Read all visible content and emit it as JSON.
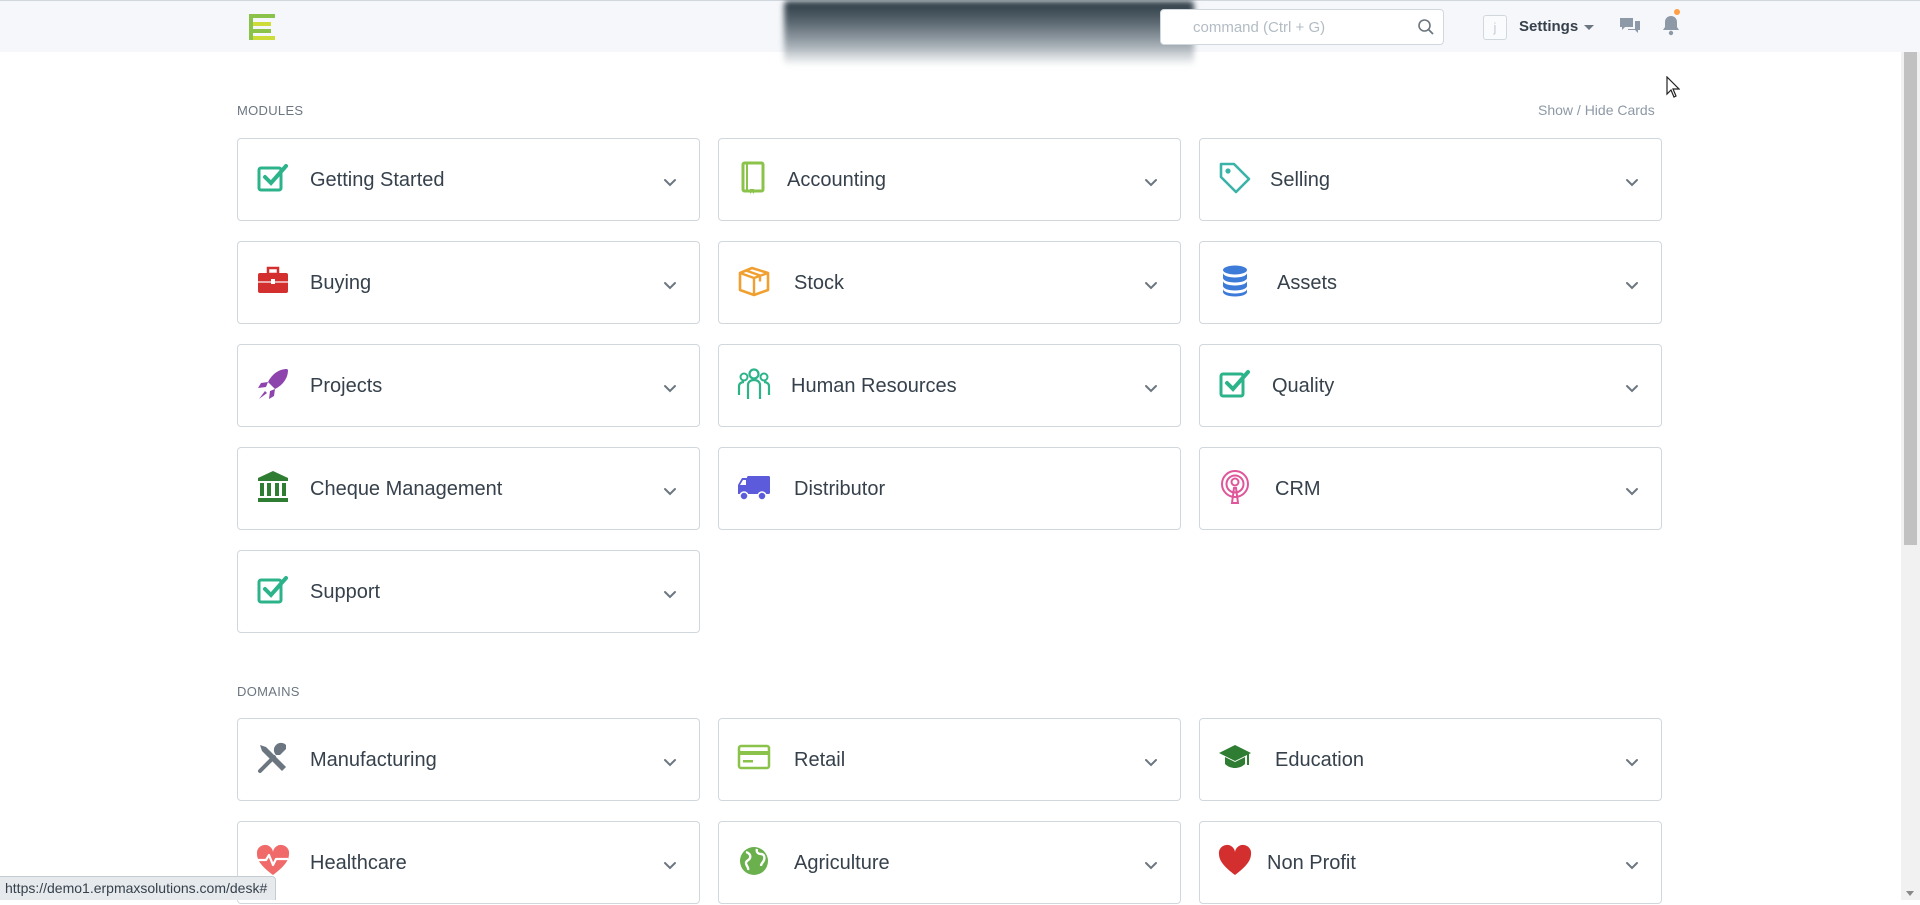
{
  "navbar": {
    "search_placeholder": "command (Ctrl + G)",
    "avatar_letter": "j",
    "settings_label": "Settings"
  },
  "modules_label": "MODULES",
  "show_hide_label": "Show / Hide Cards",
  "domains_label": "DOMAINS",
  "modules": [
    {
      "label": "Getting Started",
      "icon": "checkbox-icon",
      "color": "#2db38a",
      "has_dropdown": true
    },
    {
      "label": "Accounting",
      "icon": "book-icon",
      "color": "#8bc34a",
      "has_dropdown": true
    },
    {
      "label": "Selling",
      "icon": "tag-icon",
      "color": "#3bb3a8",
      "has_dropdown": true
    },
    {
      "label": "Buying",
      "icon": "briefcase-icon",
      "color": "#d32f2f",
      "has_dropdown": true
    },
    {
      "label": "Stock",
      "icon": "box-icon",
      "color": "#f0a030",
      "has_dropdown": true
    },
    {
      "label": "Assets",
      "icon": "database-icon",
      "color": "#3d7bd9",
      "has_dropdown": true
    },
    {
      "label": "Projects",
      "icon": "rocket-icon",
      "color": "#8e44ad",
      "has_dropdown": true
    },
    {
      "label": "Human Resources",
      "icon": "people-icon",
      "color": "#2db38a",
      "has_dropdown": true
    },
    {
      "label": "Quality",
      "icon": "checkbox-icon",
      "color": "#2db38a",
      "has_dropdown": true
    },
    {
      "label": "Cheque Management",
      "icon": "bank-icon",
      "color": "#2e7d32",
      "has_dropdown": true
    },
    {
      "label": "Distributor",
      "icon": "truck-icon",
      "color": "#5b5bdb",
      "has_dropdown": false
    },
    {
      "label": "CRM",
      "icon": "broadcast-icon",
      "color": "#e0569a",
      "has_dropdown": true
    },
    {
      "label": "Support",
      "icon": "checkbox-icon",
      "color": "#2db38a",
      "has_dropdown": true
    }
  ],
  "domains": [
    {
      "label": "Manufacturing",
      "icon": "tools-icon",
      "color": "#6c7680",
      "has_dropdown": true
    },
    {
      "label": "Retail",
      "icon": "card-icon",
      "color": "#8bc34a",
      "has_dropdown": true
    },
    {
      "label": "Education",
      "icon": "graduation-cap-icon",
      "color": "#2e7d32",
      "has_dropdown": true
    },
    {
      "label": "Healthcare",
      "icon": "heartbeat-icon",
      "color": "#f06a6a",
      "has_dropdown": true
    },
    {
      "label": "Agriculture",
      "icon": "globe-icon",
      "color": "#6ab04c",
      "has_dropdown": true
    },
    {
      "label": "Non Profit",
      "icon": "heart-icon",
      "color": "#d32f2f",
      "has_dropdown": true
    }
  ],
  "status_url": "https://demo1.erpmaxsolutions.com/desk#"
}
